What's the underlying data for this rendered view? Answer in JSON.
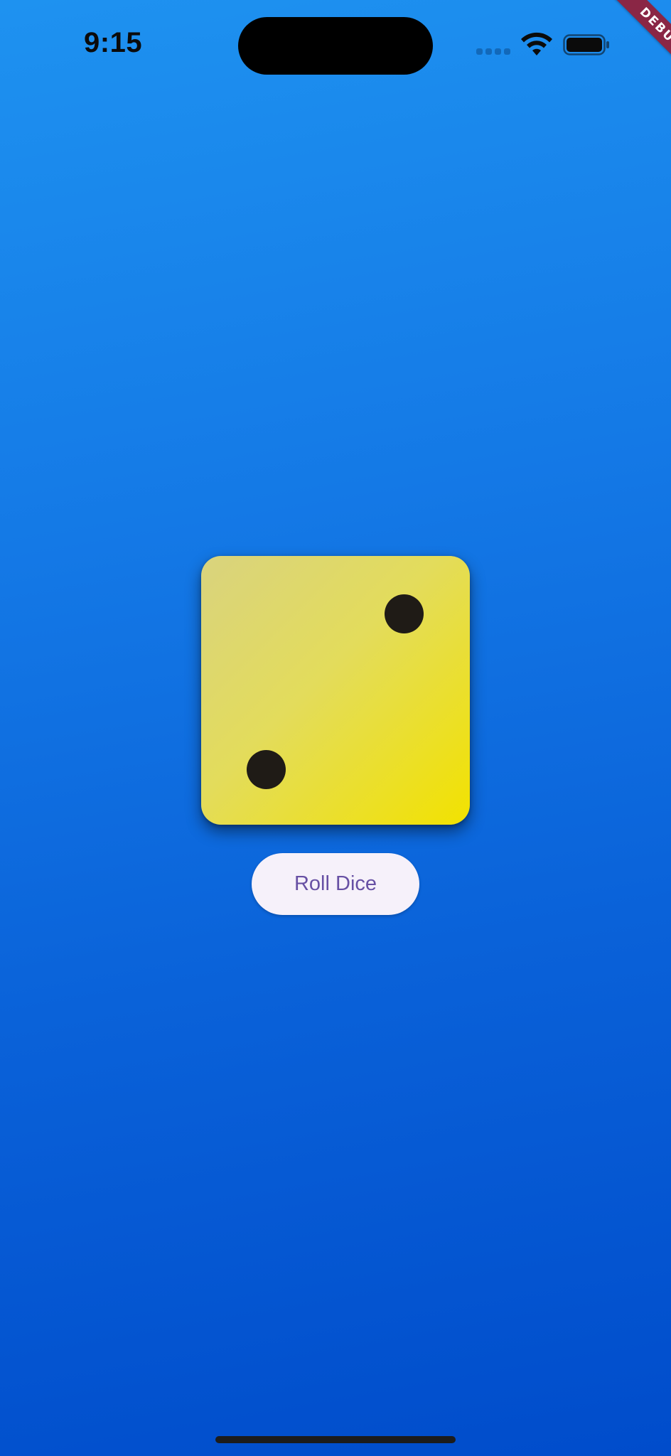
{
  "status_bar": {
    "time": "9:15",
    "icons": [
      "signal-dots-icon",
      "wifi-icon",
      "battery-icon"
    ]
  },
  "debug_banner": {
    "label": "DEBUG",
    "color": "#8a2645"
  },
  "dice": {
    "face_value": 2,
    "pip_color": "#1f1b16",
    "gradient_colors": [
      "#d9d37e",
      "#f2e200"
    ]
  },
  "roll_button": {
    "label": "Roll Dice",
    "text_color": "#6750a4",
    "background": "#f6f1fa"
  },
  "background_gradient": [
    "#1e92f0",
    "#004ccb"
  ]
}
